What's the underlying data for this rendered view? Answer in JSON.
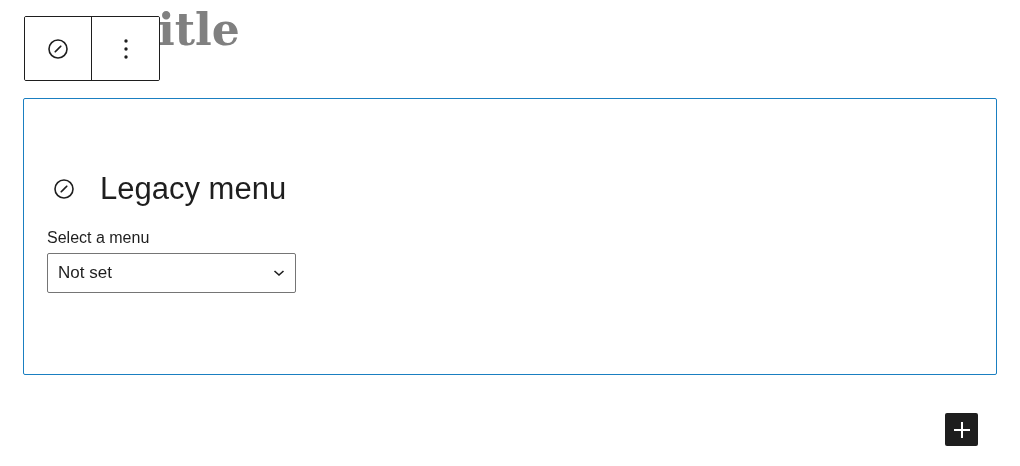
{
  "post_title": {
    "visible_text": "itle"
  },
  "block_toolbar": {
    "buttons": [
      {
        "kind": "block-type"
      },
      {
        "kind": "options"
      }
    ]
  },
  "legacy_menu_block": {
    "heading": "Legacy menu",
    "select": {
      "label": "Select a menu",
      "value": "Not set"
    }
  },
  "inserter": {
    "kind": "add"
  }
}
